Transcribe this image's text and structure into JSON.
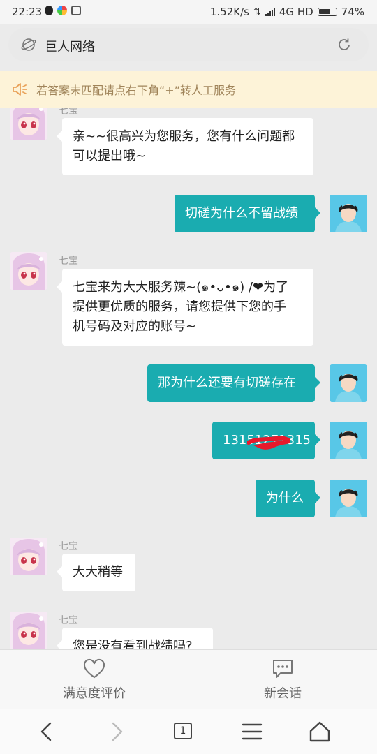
{
  "status_bar": {
    "time": "22:23",
    "speed": "1.52K/s",
    "network": "4G HD",
    "battery": "74%",
    "battery_level": 0.74
  },
  "address_bar": {
    "title": "巨人网络"
  },
  "notice": {
    "text": "若答案未匹配请点右下角“+”转人工服务"
  },
  "chat": {
    "bot_name": "七宝",
    "messages": [
      {
        "side": "left",
        "name": "七宝",
        "line1": "亲~~很高兴为您服务，您有什么问题都",
        "line2": "可以提出哦~"
      },
      {
        "side": "right",
        "text": "切磋为什么不留战绩"
      },
      {
        "side": "left",
        "name": "七宝",
        "line1": "七宝来为大大服务辣~(๑•ᴗ•๑) /❤为了",
        "line2": "提供更优质的服务，请您提供下您的手",
        "line3": "机号码及对应的账号~"
      },
      {
        "side": "right",
        "text": "那为什么还要有切磋存在"
      },
      {
        "side": "right",
        "text": "13151271315"
      },
      {
        "side": "right",
        "text": "为什么"
      },
      {
        "side": "left",
        "name": "七宝",
        "text": "大大稍等"
      },
      {
        "side": "left",
        "name": "七宝",
        "text": "您是没有看到战绩吗?"
      }
    ]
  },
  "bottom_bar": {
    "rate_label": "满意度评价",
    "new_session_label": "新会话"
  },
  "nav": {
    "tab_count": "1"
  },
  "colors": {
    "accent": "#1aacb0",
    "notice_bg": "#fdf3d8",
    "notice_text": "#a0845a"
  }
}
